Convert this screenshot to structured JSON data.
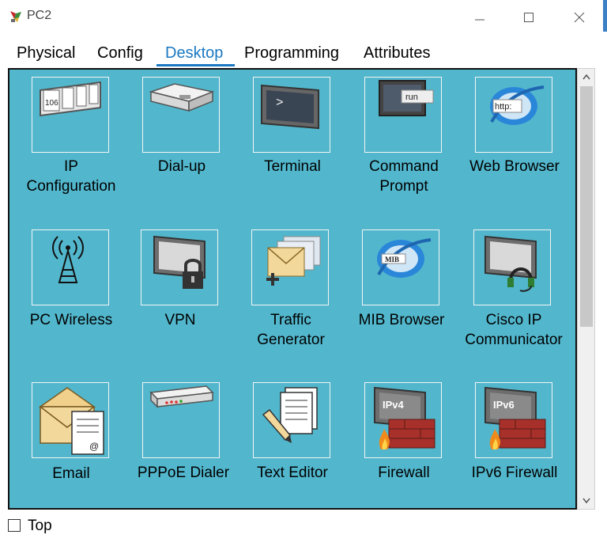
{
  "window": {
    "title": "PC2"
  },
  "tabs": [
    {
      "label": "Physical"
    },
    {
      "label": "Config"
    },
    {
      "label": "Desktop"
    },
    {
      "label": "Programming"
    },
    {
      "label": "Attributes"
    }
  ],
  "active_tab": "Desktop",
  "apps": [
    {
      "label": "IP\nConfiguration",
      "icon": "ip-configuration-icon",
      "badge": "106"
    },
    {
      "label": "Dial-up",
      "icon": "modem-icon"
    },
    {
      "label": "Terminal",
      "icon": "terminal-icon"
    },
    {
      "label": "Command\nPrompt",
      "icon": "command-prompt-icon",
      "badge": "run"
    },
    {
      "label": "Web Browser",
      "icon": "web-browser-icon",
      "badge": "http:"
    },
    {
      "label": "PC Wireless",
      "icon": "wireless-tower-icon"
    },
    {
      "label": "VPN",
      "icon": "vpn-lock-icon"
    },
    {
      "label": "Traffic\nGenerator",
      "icon": "traffic-envelopes-icon"
    },
    {
      "label": "MIB Browser",
      "icon": "mib-browser-icon",
      "badge": "MIB"
    },
    {
      "label": "Cisco IP\nCommunicator",
      "icon": "headset-monitor-icon"
    },
    {
      "label": "Email",
      "icon": "email-icon",
      "badge": "@"
    },
    {
      "label": "PPPoE Dialer",
      "icon": "pppoe-device-icon"
    },
    {
      "label": "Text Editor",
      "icon": "text-editor-icon"
    },
    {
      "label": "Firewall",
      "icon": "firewall-icon",
      "badge": "IPv4"
    },
    {
      "label": "IPv6 Firewall",
      "icon": "ipv6-firewall-icon",
      "badge": "IPv6"
    }
  ],
  "footer": {
    "top_label": "Top",
    "top_checked": false
  },
  "colors": {
    "panel": "#52b7cd",
    "active_tab": "#1a78c2"
  }
}
